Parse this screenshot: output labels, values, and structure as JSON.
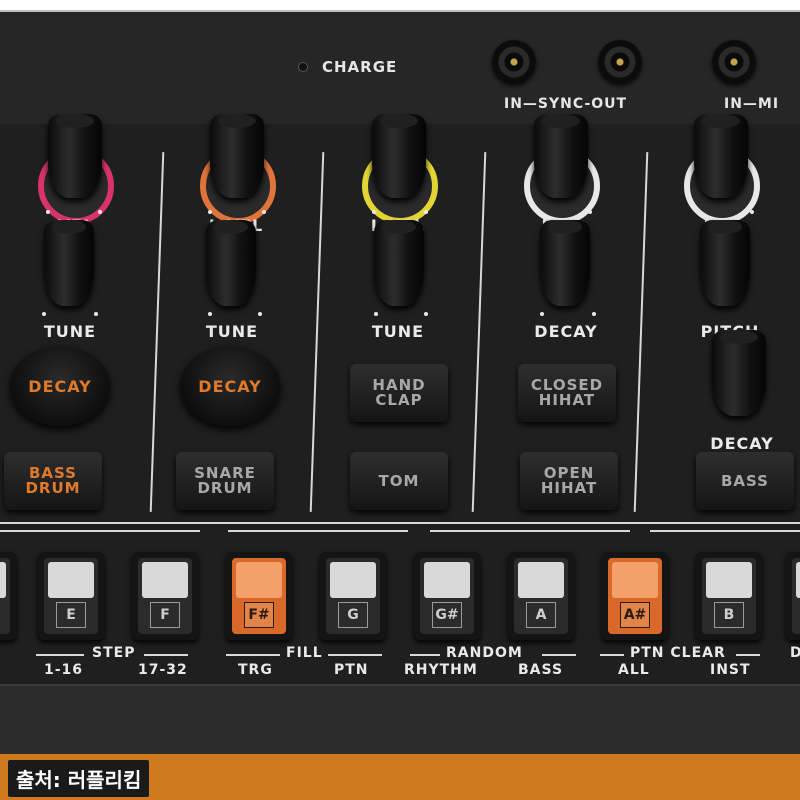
{
  "top_panel": {
    "charge_label": "CHARGE",
    "sync_label": "IN—SYNC-OUT",
    "midi_label": "IN—MI"
  },
  "channels": [
    {
      "ring_color": "#d9336a",
      "level_label": "VEL",
      "tune_label": "TUNE",
      "big_button": "DECAY",
      "instrument_line1": "BASS",
      "instrument_line2": "DRUM",
      "instrument_accent": true
    },
    {
      "ring_color": "#e0743a",
      "level_label": "L VEL",
      "tune_label": "TUNE",
      "big_button": "DECAY",
      "instrument_line1": "SNARE",
      "instrument_line2": "DRUM",
      "instrument_accent": false
    },
    {
      "ring_color": "#e3d534",
      "level_label": "L VEL",
      "tune_label": "TUNE",
      "button_line1": "HAND",
      "button_line2": "CLAP",
      "instrument_line1": "TOM",
      "instrument_line2": "",
      "instrument_accent": false
    },
    {
      "ring_color": "#e8e8e8",
      "level_label": "LE L",
      "tune_label": "DECAY",
      "button_line1": "CLOSED",
      "button_line2": "HIHAT",
      "instrument_line1": "OPEN",
      "instrument_line2": "HIHAT",
      "instrument_accent": false
    },
    {
      "ring_color": "#e8e8e8",
      "level_label": "LE L",
      "tune_label": "PITCH",
      "extra_knob_label": "DECAY",
      "instrument_line1": "BASS",
      "instrument_line2": "",
      "instrument_accent": false
    }
  ],
  "step_keys": [
    {
      "key": "E",
      "lit": false
    },
    {
      "key": "F",
      "lit": false
    },
    {
      "key": "F#",
      "lit": true
    },
    {
      "key": "G",
      "lit": false
    },
    {
      "key": "G#",
      "lit": false
    },
    {
      "key": "A",
      "lit": false
    },
    {
      "key": "A#",
      "lit": true
    },
    {
      "key": "B",
      "lit": false
    }
  ],
  "function_groups": {
    "step": {
      "title": "STEP",
      "left": "1-16",
      "right": "17-32"
    },
    "fill": {
      "title": "FILL",
      "left": "TRG",
      "right": "PTN"
    },
    "random": {
      "title": "RANDOM",
      "left": "RHYTHM",
      "right": "BASS"
    },
    "ptn_clear": {
      "title": "PTN CLEAR",
      "left": "ALL",
      "right": "INST"
    },
    "edge": "D"
  },
  "caption": "출처: 러플리킴",
  "colors": {
    "accent_orange": "#e07a2a",
    "step_lit": "#d8692a",
    "strip_orange": "#d07a1f"
  }
}
